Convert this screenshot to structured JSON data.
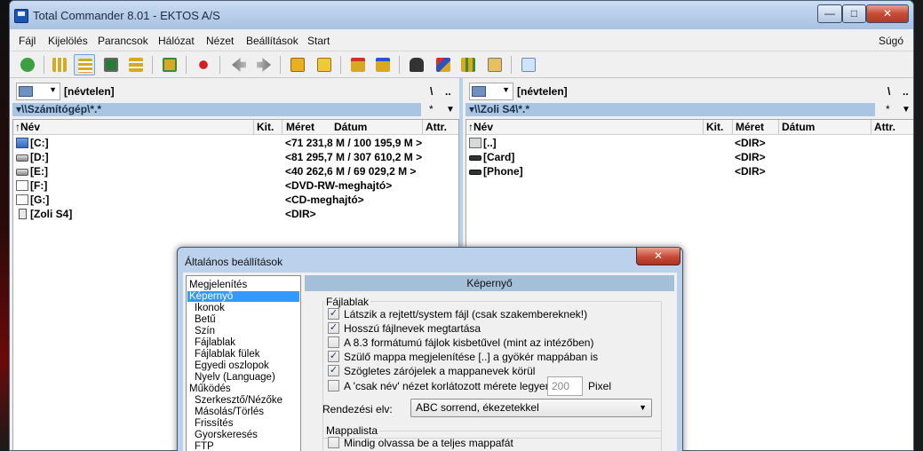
{
  "window": {
    "title": "Total Commander 8.01 - EKTOS A/S",
    "controls": {
      "minimize": "—",
      "maximize": "□",
      "close": "✕"
    }
  },
  "menu": {
    "items": [
      "Fájl",
      "Kijelölés",
      "Parancsok",
      "Hálózat",
      "Nézet",
      "Beállítások",
      "Start"
    ],
    "help": "Súgó"
  },
  "toolbar": {
    "icons": [
      "refresh-icon",
      "brief-view-icon",
      "full-view-icon",
      "thumbnail-icon",
      "tree-view-icon",
      "sync-dirs-icon",
      "mark-icon",
      "back-icon",
      "forward-icon",
      "pack-icon",
      "unpack-icon",
      "ftp-icon",
      "url-icon",
      "search-icon",
      "rename-icon",
      "compare-icon",
      "copy-names-icon",
      "notepad-icon"
    ]
  },
  "left_panel": {
    "volume_label": "[névtelen]",
    "root_button": "\\",
    "up_button": "..",
    "path": "▾\\\\Számítógép\\*.*",
    "filter": "*",
    "filter_arrow": "▼",
    "columns": {
      "name": "↑Név",
      "ext": "Kit.",
      "size": "Méret",
      "date": "Dátum",
      "attr": "Attr."
    },
    "rows": [
      {
        "name": "[C:]",
        "size": "<71 231,8 M / 100 195,9 M >",
        "icon": "system-drive-icon"
      },
      {
        "name": "[D:]",
        "size": "<81 295,7 M / 307 610,2 M >",
        "icon": "hard-drive-icon"
      },
      {
        "name": "[E:]",
        "size": "<40 262,6 M / 69 029,2 M >",
        "icon": "hard-drive-icon"
      },
      {
        "name": "[F:]",
        "size": "<DVD-RW-meghajtó>",
        "icon": "dvd-drive-icon"
      },
      {
        "name": "[G:]",
        "size": "<CD-meghajtó>",
        "icon": "cd-drive-icon"
      },
      {
        "name": "[Zoli S4]",
        "size": "<DIR>",
        "icon": "phone-icon"
      }
    ]
  },
  "right_panel": {
    "volume_label": "[névtelen]",
    "root_button": "\\",
    "up_button": "..",
    "path": "▾\\\\Zoli S4\\*.*",
    "filter": "*",
    "filter_arrow": "▼",
    "columns": {
      "name": "↑Név",
      "ext": "Kit.",
      "size": "Méret",
      "date": "Dátum",
      "attr": "Attr."
    },
    "rows": [
      {
        "name": "[..]",
        "size": "<DIR>",
        "icon": "up-dir-icon"
      },
      {
        "name": "[Card]",
        "size": "<DIR>",
        "icon": "card-icon"
      },
      {
        "name": "[Phone]",
        "size": "<DIR>",
        "icon": "card-icon"
      }
    ]
  },
  "dialog": {
    "title": "Általános beállítások",
    "close": "✕",
    "nav": [
      {
        "label": "Megjelenítés",
        "level": 0
      },
      {
        "label": "Képernyő",
        "level": 0,
        "selected": true
      },
      {
        "label": "Ikonok",
        "level": 1
      },
      {
        "label": "Betű",
        "level": 1
      },
      {
        "label": "Szín",
        "level": 1
      },
      {
        "label": "Fájlablak",
        "level": 1
      },
      {
        "label": "Fájlablak fülek",
        "level": 1
      },
      {
        "label": "Egyedi oszlopok",
        "level": 1
      },
      {
        "label": "Nyelv (Language)",
        "level": 1
      },
      {
        "label": "Működés",
        "level": 0
      },
      {
        "label": "Szerkesztő/Nézőke",
        "level": 1
      },
      {
        "label": "Másolás/Törlés",
        "level": 1
      },
      {
        "label": "Frissítés",
        "level": 1
      },
      {
        "label": "Gyorskeresés",
        "level": 1
      },
      {
        "label": "FTP",
        "level": 1
      }
    ],
    "page_title": "Képernyő",
    "group1_title": "Fájlablak",
    "checkboxes": [
      {
        "label": "Látszik a rejtett/system fájl (csak szakembereknek!)",
        "checked": true
      },
      {
        "label": "Hosszú fájlnevek megtartása",
        "checked": true
      },
      {
        "label": "A 8.3 formátumú fájlok kisbetűvel (mint az intézőben)",
        "checked": false
      },
      {
        "label": "Szülő mappa megjelenítése [..] a gyökér mappában is",
        "checked": true
      },
      {
        "label": "Szögletes zárójelek a mappanevek körül",
        "checked": true
      },
      {
        "label": "A 'csak név' nézet korlátozott mérete legyen:",
        "checked": false
      }
    ],
    "pixel_value": "200",
    "pixel_unit": "Pixel",
    "sort_label": "Rendezési elv:",
    "sort_value": "ABC sorrend, ékezetekkel",
    "group2_title": "Mappalista",
    "checkboxes2": [
      {
        "label": "Mindig olvassa be a teljes mappafát",
        "checked": false
      }
    ]
  }
}
